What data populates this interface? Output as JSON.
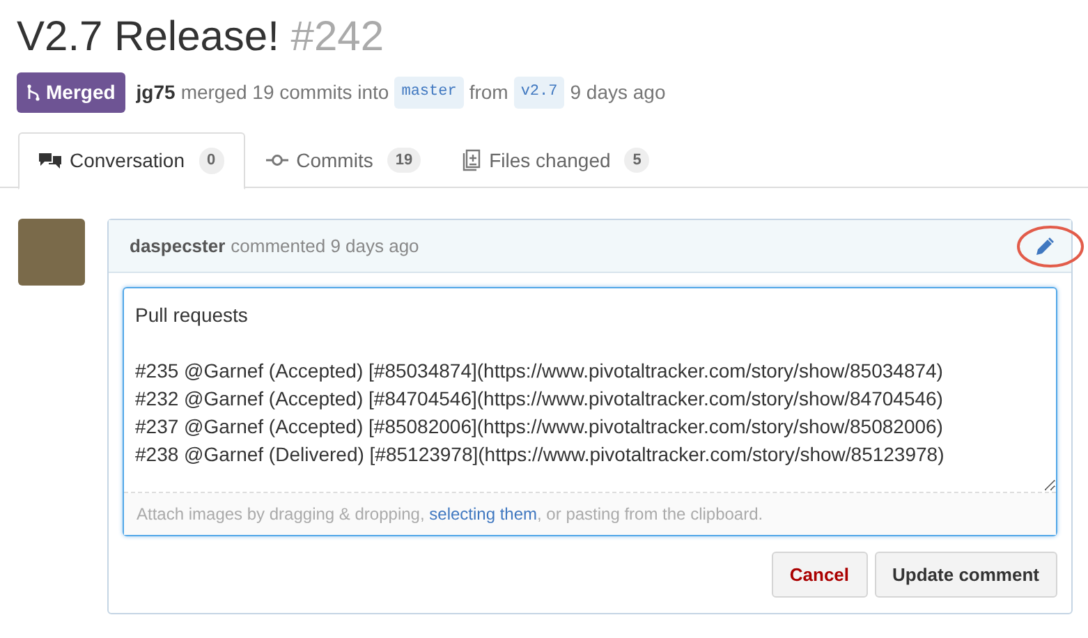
{
  "title": {
    "name": "V2.7 Release!",
    "number": "#242"
  },
  "status": {
    "badge": "Merged",
    "author": "jg75",
    "text": "merged 19 commits into",
    "base": "master",
    "from": "from",
    "head": "v2.7",
    "time": "9 days ago"
  },
  "tabs": [
    {
      "label": "Conversation",
      "count": "0",
      "selected": true
    },
    {
      "label": "Commits",
      "count": "19",
      "selected": false
    },
    {
      "label": "Files changed",
      "count": "5",
      "selected": false
    }
  ],
  "comment": {
    "author": "daspecster",
    "action": "commented 9 days ago",
    "heading": "Pull requests",
    "lines": [
      "#235 @Garnef (Accepted) [#85034874](https://www.pivotaltracker.com/story/show/85034874)",
      "#232 @Garnef (Accepted) [#84704546](https://www.pivotaltracker.com/story/show/84704546)",
      "#237 @Garnef (Accepted) [#85082006](https://www.pivotaltracker.com/story/show/85082006)",
      "#238 @Garnef (Delivered) [#85123978](https://www.pivotaltracker.com/story/show/85123978)"
    ],
    "hint_before": "Attach images by dragging & dropping,",
    "hint_link": "selecting them",
    "hint_after": ", or pasting from the clipboard.",
    "buttons": [
      {
        "kind": "cancel",
        "label": "Cancel"
      },
      {
        "kind": "primary",
        "label": "Update comment"
      }
    ]
  }
}
